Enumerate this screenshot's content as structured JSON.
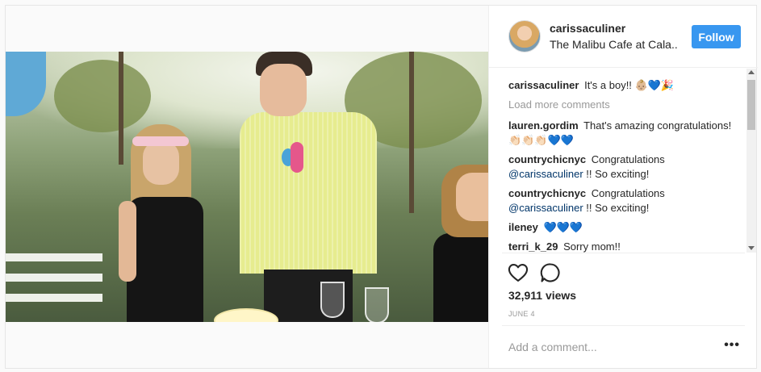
{
  "post": {
    "image_alt": "",
    "user": {
      "username": "carissaculiner",
      "location": "The Malibu Cafe at Cala...",
      "follow_label": "Follow"
    },
    "caption": {
      "author": "carissaculiner",
      "text": "It's a boy!! 👶🏼💙🎉"
    },
    "load_more_label": "Load more comments",
    "comments": [
      {
        "author": "lauren.gordim",
        "pre": "That's amazing congratulations!👏🏻👏🏻👏🏻💙💙",
        "mention": "",
        "post": ""
      },
      {
        "author": "countrychicnyc",
        "pre": "Congratulations ",
        "mention": "@carissaculiner",
        "post": " !! So exciting!"
      },
      {
        "author": "countrychicnyc",
        "pre": "Congratulations ",
        "mention": "@carissaculiner",
        "post": " !! So exciting!"
      },
      {
        "author": "ileney",
        "pre": "💙💙💙",
        "mention": "",
        "post": ""
      },
      {
        "author": "terri_k_29",
        "pre": "Sorry mom!!",
        "mention": "",
        "post": ""
      }
    ],
    "views": "32,911 views",
    "date": "JUNE 4",
    "add_comment_placeholder": "Add a comment...",
    "more_options": "•••",
    "icons": {
      "like": "heart-icon",
      "comment": "speech-bubble-icon",
      "options": "more-options-icon"
    },
    "colors": {
      "follow": "#3897f0",
      "mention": "#003569",
      "muted": "#999999"
    }
  }
}
